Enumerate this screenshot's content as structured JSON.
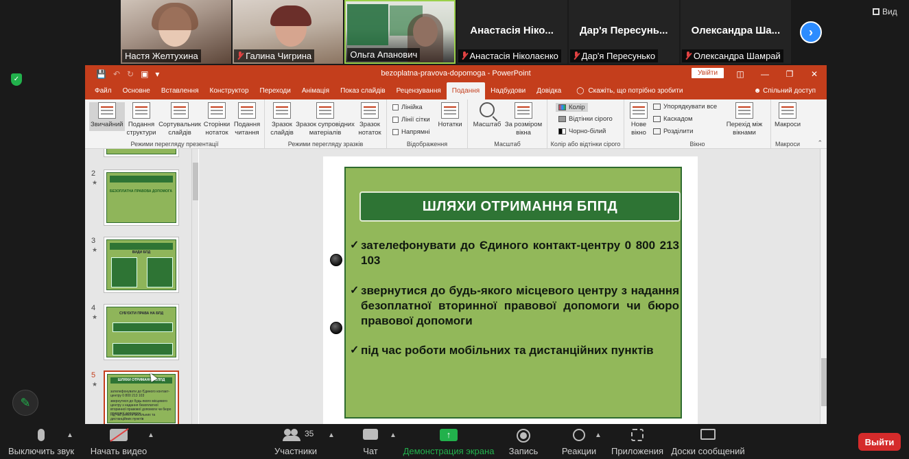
{
  "participants": [
    {
      "name": "Настя Желтухина",
      "display": "",
      "muted": false,
      "video": true
    },
    {
      "name": "Галина Чигрина",
      "display": "",
      "muted": true,
      "video": true
    },
    {
      "name": "Ольга Апанович",
      "display": "",
      "muted": false,
      "video": true,
      "active": true
    },
    {
      "name": "Анастасія Ніколаєнко",
      "display": "Анастасія Ніко...",
      "muted": true,
      "video": false
    },
    {
      "name": "Дар'я Пересунько",
      "display": "Дар'я Пересунь...",
      "muted": true,
      "video": false
    },
    {
      "name": "Олександра Шамрай",
      "display": "Олександра Ша...",
      "muted": true,
      "video": false
    }
  ],
  "view_label": "Вид",
  "ppt": {
    "doc_title": "bezoplatna-pravova-dopomoga  -  PowerPoint",
    "signin_label": "Увійти",
    "tabs": [
      "Файл",
      "Основне",
      "Вставлення",
      "Конструктор",
      "Переходи",
      "Анімація",
      "Показ слайдів",
      "Рецензування",
      "Подання",
      "Надбудови",
      "Довідка"
    ],
    "active_tab": "Подання",
    "tell_me": "Скажіть, що потрібно зробити",
    "share": "Спільний доступ",
    "ribbon": {
      "views": {
        "name": "Режими перегляду презентації",
        "buttons": [
          "Звичайний",
          "Подання структури",
          "Сортувальник слайдів",
          "Сторінки нотаток",
          "Подання читання"
        ]
      },
      "masters": {
        "name": "Режими перегляду зразків",
        "buttons": [
          "Зразок слайдів",
          "Зразок супровідних матеріалів",
          "Зразок нотаток"
        ]
      },
      "show": {
        "name": "Відображення",
        "checks": [
          "Лінійка",
          "Лінії сітки",
          "Напрямні"
        ],
        "notes": "Нотатки"
      },
      "zoom": {
        "name": "Масштаб",
        "buttons": [
          "Масштаб",
          "За розміром вікна"
        ]
      },
      "color": {
        "name": "Колір або відтінки сірого",
        "items": [
          "Колір",
          "Відтінки сірого",
          "Чорно-білий"
        ]
      },
      "window": {
        "name": "Вікно",
        "new": "Нове вікно",
        "items": [
          "Упорядкувати все",
          "Каскадом",
          "Розділити"
        ],
        "switch": "Перехід між вікнами"
      },
      "macros": {
        "name": "Макроси",
        "button": "Макроси"
      }
    },
    "thumbnails": [
      {
        "num": "2",
        "title": "БЕЗОПЛАТНА ПРАВОВА ДОПОМОГА"
      },
      {
        "num": "3",
        "title": "ВИДИ БПД"
      },
      {
        "num": "4",
        "title": "СУБ'ЄКТИ ПРАВА НА БПД"
      },
      {
        "num": "5",
        "title": "ШЛЯХИ ОТРИМАННЯ БППД"
      }
    ],
    "slide": {
      "title": "ШЛЯХИ ОТРИМАННЯ БППД",
      "bullets": [
        "зателефонувати до Єдиного контакт-центру 0 800 213 103",
        "звернутися до будь-якого місцевого центру з надання безоплатної вторинної правової допомоги чи бюро правової допомоги",
        "під час роботи мобільних та дистанційних пунктів"
      ]
    }
  },
  "toolbar": {
    "mute": "Выключить звук",
    "video": "Начать видео",
    "participants": "Участники",
    "participants_count": "35",
    "chat": "Чат",
    "share": "Демонстрация экрана",
    "record": "Запись",
    "reactions": "Реакции",
    "apps": "Приложения",
    "whiteboards": "Доски сообщений",
    "leave": "Выйти"
  },
  "colors": {
    "ppt_accent": "#c43e1c",
    "slide_green": "#92b85a",
    "slide_title_bg": "#2e7434",
    "share_green": "#22b14c",
    "leave_red": "#d52b2b"
  }
}
